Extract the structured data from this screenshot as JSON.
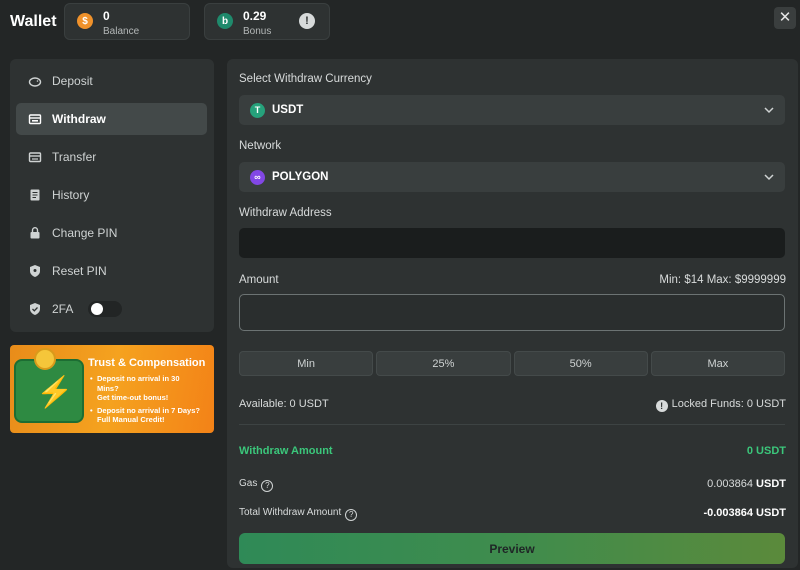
{
  "header": {
    "title": "Wallet",
    "balance": {
      "amount": "0",
      "label": "Balance",
      "coin": "$",
      "color": "#f0922b"
    },
    "bonus": {
      "amount": "0.29",
      "label": "Bonus",
      "coin": "b",
      "color": "#1f8a6c"
    },
    "info_icon": "!",
    "close_icon": "✕"
  },
  "sidebar": {
    "items": [
      {
        "label": "Deposit",
        "icon": "piggy-bank-icon"
      },
      {
        "label": "Withdraw",
        "icon": "withdraw-icon",
        "active": true
      },
      {
        "label": "Transfer",
        "icon": "transfer-icon"
      },
      {
        "label": "History",
        "icon": "history-icon"
      },
      {
        "label": "Change PIN",
        "icon": "lock-icon"
      },
      {
        "label": "Reset PIN",
        "icon": "shield-icon"
      },
      {
        "label": "2FA",
        "icon": "shield-check-icon",
        "toggle": false
      }
    ]
  },
  "promo": {
    "title": "Trust & Compensation",
    "line1": "Deposit no arrival in 30",
    "line1b": "Mins?",
    "line1c": "Get time-out bonus!",
    "line2": "Deposit no arrival in 7 Days?",
    "line2b": "Full Manual Credit!"
  },
  "form": {
    "currency_label": "Select Withdraw Currency",
    "currency": {
      "value": "USDT",
      "icon_glyph": "T",
      "color": "#26a17b"
    },
    "network_label": "Network",
    "network": {
      "value": "POLYGON",
      "icon_glyph": "∞",
      "color": "#8247e5"
    },
    "address_label": "Withdraw Address",
    "address_value": "",
    "amount_label": "Amount",
    "amount_limits": "Min: $14 Max: $9999999",
    "amount_value": "",
    "quick": [
      "Min",
      "25%",
      "50%",
      "Max"
    ],
    "available": "Available: 0 USDT",
    "locked": "Locked Funds: 0 USDT",
    "withdraw_amount_label": "Withdraw Amount",
    "withdraw_amount_value": "0 USDT",
    "gas_label": "Gas",
    "gas_value": "0.003864",
    "gas_unit": "USDT",
    "total_label": "Total Withdraw Amount",
    "total_value": "-0.003864",
    "total_unit": "USDT",
    "preview": "Preview"
  }
}
